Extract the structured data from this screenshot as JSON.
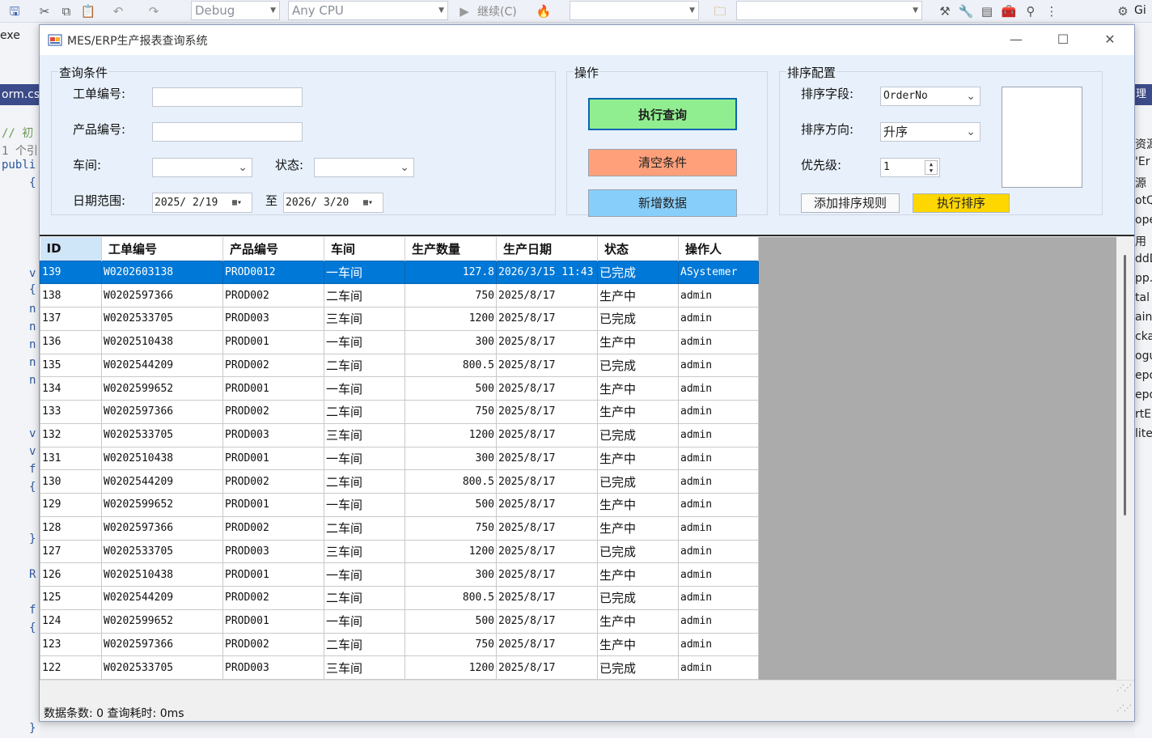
{
  "ide": {
    "toolbar": {
      "config": "Debug",
      "platform": "Any CPU",
      "continue_label": "继续(C)",
      "git_label": "Gi"
    },
    "left_fragments": [
      "exe",
      "orm.cs",
      "// 初",
      "1 个引",
      "publi",
      "{",
      "v",
      "{",
      "n",
      "n",
      "n",
      "n",
      "n",
      "v",
      "v",
      "f",
      "{",
      "}",
      "R",
      "f",
      "{",
      "}"
    ],
    "right_fragments": [
      "理",
      "资源",
      "'Er",
      "源",
      "otQ",
      "ope",
      "用",
      "ddD",
      "pp.c",
      "tal",
      "ainl",
      "cka",
      "ogu",
      "epo",
      "epo",
      "rtE",
      "lite"
    ]
  },
  "window": {
    "title": "MES/ERP生产报表查询系统",
    "minimize": "—",
    "maximize": "☐",
    "close": "✕"
  },
  "query": {
    "group_title": "查询条件",
    "order_no_label": "工单编号:",
    "order_no_value": "",
    "product_no_label": "产品编号:",
    "product_no_value": "",
    "workshop_label": "车间:",
    "workshop_value": "",
    "status_label": "状态:",
    "status_value": "",
    "date_range_label": "日期范围:",
    "date_from": "2025/ 2/19",
    "date_to_sep": "至",
    "date_to": "2026/ 3/20"
  },
  "actions": {
    "group_title": "操作",
    "execute_query": "执行查询",
    "clear_conditions": "清空条件",
    "add_data": "新增数据"
  },
  "sort": {
    "group_title": "排序配置",
    "field_label": "排序字段:",
    "field_value": "OrderNo",
    "direction_label": "排序方向:",
    "direction_value": "升序",
    "priority_label": "优先级:",
    "priority_value": "1",
    "add_rule": "添加排序规则",
    "execute_sort": "执行排序",
    "rules": []
  },
  "colors": {
    "query_btn": "#90ee90",
    "clear_btn": "#ffa07a",
    "add_btn": "#87cefa",
    "sort_btn": "#ffd700",
    "selection": "#0078d7"
  },
  "grid": {
    "columns": [
      "ID",
      "工单编号",
      "产品编号",
      "车间",
      "生产数量",
      "生产日期",
      "状态",
      "操作人"
    ],
    "selected_row": 0,
    "rows": [
      [
        "139",
        "W0202603138",
        "PROD0012",
        "一车间",
        "127.8",
        "2026/3/15 11:43",
        "已完成",
        "ASystemer"
      ],
      [
        "138",
        "W0202597366",
        "PROD002",
        "二车间",
        "750",
        "2025/8/17",
        "生产中",
        "admin"
      ],
      [
        "137",
        "W0202533705",
        "PROD003",
        "三车间",
        "1200",
        "2025/8/17",
        "已完成",
        "admin"
      ],
      [
        "136",
        "W0202510438",
        "PROD001",
        "一车间",
        "300",
        "2025/8/17",
        "生产中",
        "admin"
      ],
      [
        "135",
        "W0202544209",
        "PROD002",
        "二车间",
        "800.5",
        "2025/8/17",
        "已完成",
        "admin"
      ],
      [
        "134",
        "W0202599652",
        "PROD001",
        "一车间",
        "500",
        "2025/8/17",
        "生产中",
        "admin"
      ],
      [
        "133",
        "W0202597366",
        "PROD002",
        "二车间",
        "750",
        "2025/8/17",
        "生产中",
        "admin"
      ],
      [
        "132",
        "W0202533705",
        "PROD003",
        "三车间",
        "1200",
        "2025/8/17",
        "已完成",
        "admin"
      ],
      [
        "131",
        "W0202510438",
        "PROD001",
        "一车间",
        "300",
        "2025/8/17",
        "生产中",
        "admin"
      ],
      [
        "130",
        "W0202544209",
        "PROD002",
        "二车间",
        "800.5",
        "2025/8/17",
        "已完成",
        "admin"
      ],
      [
        "129",
        "W0202599652",
        "PROD001",
        "一车间",
        "500",
        "2025/8/17",
        "生产中",
        "admin"
      ],
      [
        "128",
        "W0202597366",
        "PROD002",
        "二车间",
        "750",
        "2025/8/17",
        "生产中",
        "admin"
      ],
      [
        "127",
        "W0202533705",
        "PROD003",
        "三车间",
        "1200",
        "2025/8/17",
        "已完成",
        "admin"
      ],
      [
        "126",
        "W0202510438",
        "PROD001",
        "一车间",
        "300",
        "2025/8/17",
        "生产中",
        "admin"
      ],
      [
        "125",
        "W0202544209",
        "PROD002",
        "二车间",
        "800.5",
        "2025/8/17",
        "已完成",
        "admin"
      ],
      [
        "124",
        "W0202599652",
        "PROD001",
        "一车间",
        "500",
        "2025/8/17",
        "生产中",
        "admin"
      ],
      [
        "123",
        "W0202597366",
        "PROD002",
        "二车间",
        "750",
        "2025/8/17",
        "生产中",
        "admin"
      ],
      [
        "122",
        "W0202533705",
        "PROD003",
        "三车间",
        "1200",
        "2025/8/17",
        "已完成",
        "admin"
      ]
    ]
  },
  "status": {
    "text": "数据条数: 0  查询耗时: 0ms"
  }
}
